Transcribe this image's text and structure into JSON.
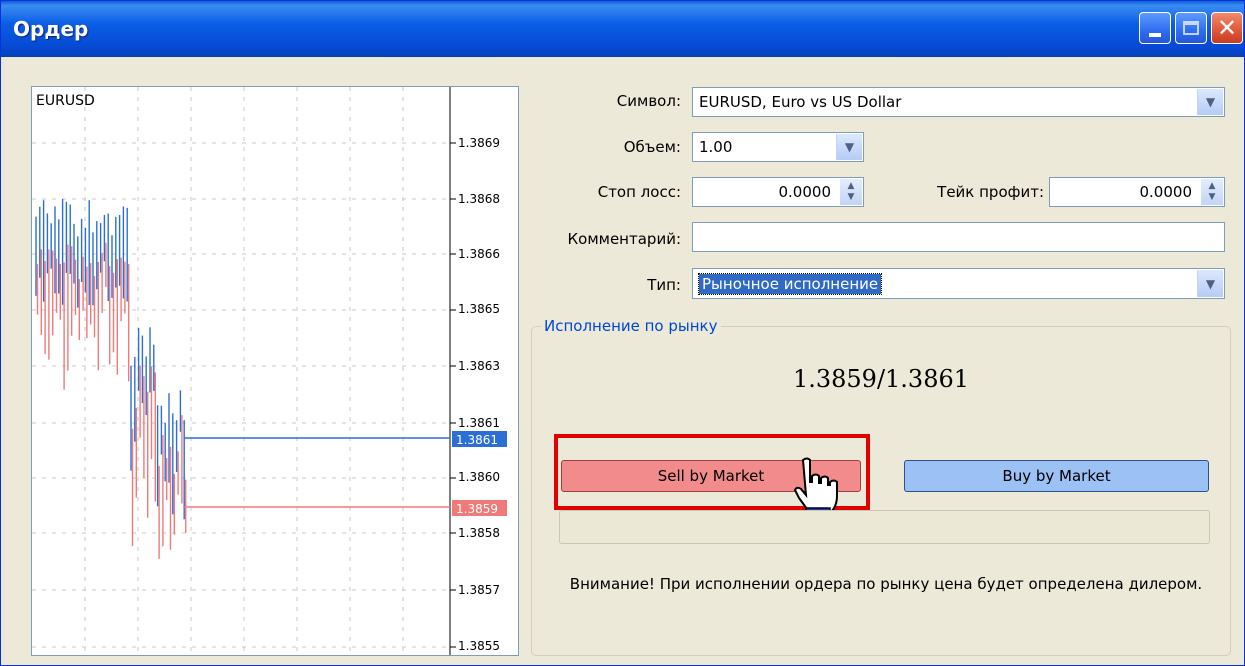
{
  "window": {
    "title": "Ордер",
    "controls": [
      "minimize-icon",
      "maximize-icon",
      "close-icon"
    ]
  },
  "chart": {
    "symbol": "EURUSD",
    "price_axis": [
      "1.3869",
      "1.3868",
      "1.3866",
      "1.3865",
      "1.3863",
      "1.3861",
      "1.3860",
      "1.3858",
      "1.3857",
      "1.3855"
    ],
    "ask_label": "1.3861",
    "bid_label": "1.3859",
    "ask_color": "#2b6fd6",
    "bid_color": "#f07a7a"
  },
  "form": {
    "symbol_label": "Символ:",
    "symbol_value": "EURUSD, Euro vs US Dollar",
    "volume_label": "Объем:",
    "volume_value": "1.00",
    "stoploss_label": "Стоп лосс:",
    "stoploss_value": "0.0000",
    "takeprofit_label": "Тейк профит:",
    "takeprofit_value": "0.0000",
    "comment_label": "Комментарий:",
    "comment_value": "",
    "type_label": "Тип:",
    "type_value": "Рыночное исполнение"
  },
  "execution": {
    "group_title": "Исполнение по рынку",
    "price": "1.3859/1.3861",
    "sell_label": "Sell by Market",
    "buy_label": "Buy by Market",
    "sell_color": "#f28b8b",
    "buy_color": "#9cc1f5",
    "notice": "Внимание! При исполнении ордера по рынку цена будет определена дилером."
  }
}
